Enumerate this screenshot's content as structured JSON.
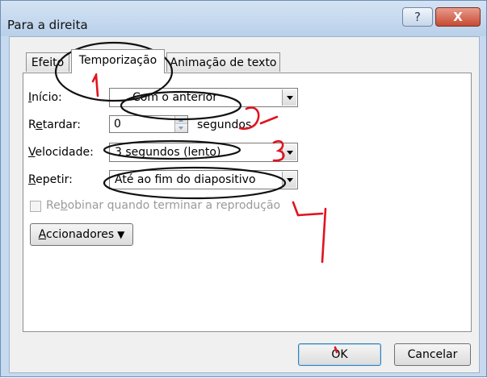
{
  "window": {
    "title": "Para a direita",
    "help_label": "?",
    "close_label": "X"
  },
  "tabs": [
    {
      "label": "Efeito",
      "active": false
    },
    {
      "label": "Temporização",
      "active": true
    },
    {
      "label": "Animação de texto",
      "active": false
    }
  ],
  "form": {
    "inicio": {
      "label": "Início:",
      "value": "Com o anterior"
    },
    "retardar": {
      "label": "Retardar:",
      "value": "0",
      "unit": "segundos"
    },
    "velocidade": {
      "label": "Velocidade:",
      "value": "3 segundos (lento)"
    },
    "repetir": {
      "label": "Repetir:",
      "value": "Até ao fim do diapositivo"
    },
    "rebobinar": {
      "label": "Rebobinar quando terminar a reprodução",
      "checked": false,
      "enabled": false
    },
    "accionadores_label": "Accionadores"
  },
  "buttons": {
    "ok": "OK",
    "cancel": "Cancelar"
  },
  "annotations": {
    "numbers": [
      "1",
      "2",
      "3",
      "4"
    ],
    "color": "#e0141e"
  }
}
